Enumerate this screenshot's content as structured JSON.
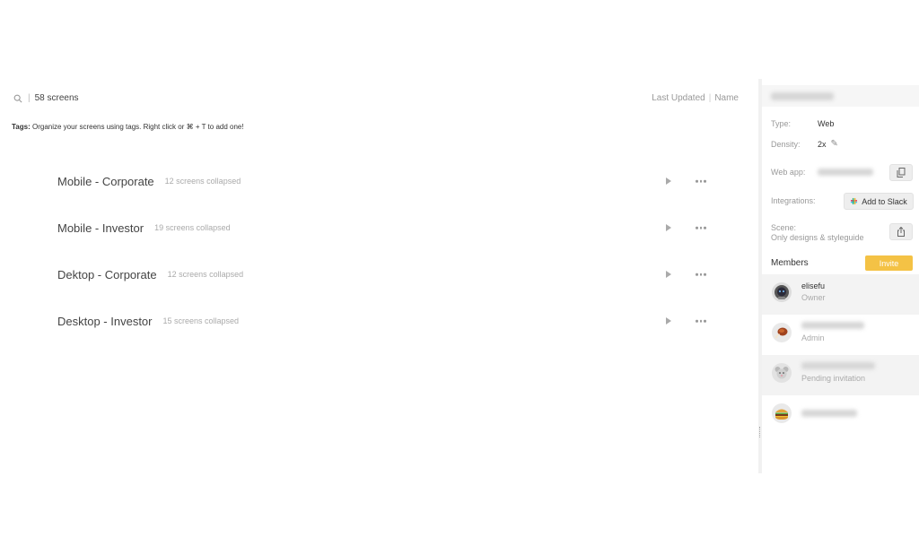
{
  "toolbar": {
    "screen_count": "58 screens",
    "sort_last_updated": "Last Updated",
    "sort_separator": "|",
    "sort_name": "Name"
  },
  "tags": {
    "label": "Tags:",
    "hint": "Organize your screens using tags. Right click or ⌘ + T to add one!"
  },
  "sections": [
    {
      "name": "Mobile - Corporate",
      "count": "12 screens collapsed"
    },
    {
      "name": "Mobile - Investor",
      "count": "19 screens collapsed"
    },
    {
      "name": "Dektop - Corporate",
      "count": "12 screens collapsed"
    },
    {
      "name": "Desktop - Investor",
      "count": "15 screens collapsed"
    }
  ],
  "panel": {
    "project_name": "",
    "type_label": "Type:",
    "type_value": "Web",
    "density_label": "Density:",
    "density_value": "2x",
    "webapp_label": "Web app:",
    "integrations_label": "Integrations:",
    "add_to_slack": "Add to Slack",
    "scene_label": "Scene:",
    "scene_value": "Only designs & styleguide",
    "members_label": "Members",
    "invite_label": "Invite"
  },
  "members": [
    {
      "name": "elisefu",
      "role": "Owner",
      "avatar": "astronaut-icon"
    },
    {
      "name": "",
      "role": "Admin",
      "avatar": "chicken-leg-icon"
    },
    {
      "name": "",
      "role": "Pending invitation",
      "avatar": "mouse-icon"
    },
    {
      "name": "",
      "role": "",
      "avatar": "burger-icon"
    }
  ],
  "colors": {
    "invite": "#f4c245",
    "panel_shade": "#f3f3f3"
  }
}
